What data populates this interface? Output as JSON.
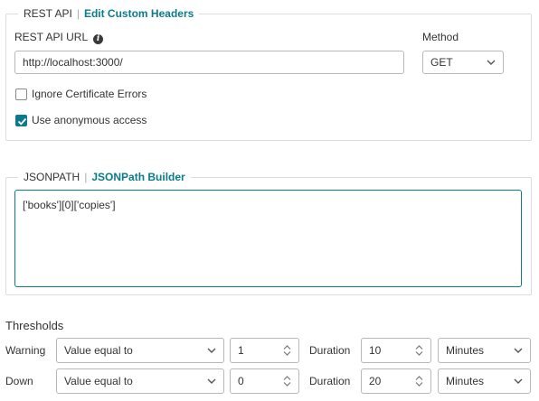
{
  "rest_api": {
    "section_title": "REST API",
    "edit_link": "Edit Custom Headers",
    "url_label": "REST API URL",
    "url_value": "http://localhost:3000/",
    "method_label": "Method",
    "method_value": "GET",
    "ignore_cert_label": "Ignore Certificate Errors",
    "ignore_cert_checked": false,
    "anon_access_label": "Use anonymous access",
    "anon_access_checked": true
  },
  "jsonpath": {
    "section_title": "JSONPATH",
    "builder_link": "JSONPath Builder",
    "value": "['books'][0]['copies']"
  },
  "thresholds": {
    "title": "Thresholds",
    "duration_label": "Duration",
    "rows": [
      {
        "label": "Warning",
        "condition": "Value equal to",
        "value": "1",
        "duration": "10",
        "unit": "Minutes"
      },
      {
        "label": "Down",
        "condition": "Value equal to",
        "value": "0",
        "duration": "20",
        "unit": "Minutes"
      }
    ]
  },
  "colors": {
    "accent": "#0a7b8a",
    "border": "#dcdcdc",
    "input_border": "#b8b8b8"
  },
  "icons": {
    "info": "info-icon",
    "chevron": "chevron-down-icon",
    "check": "checkmark-icon",
    "spinner_up": "spinner-up-icon",
    "spinner_down": "spinner-down-icon"
  }
}
